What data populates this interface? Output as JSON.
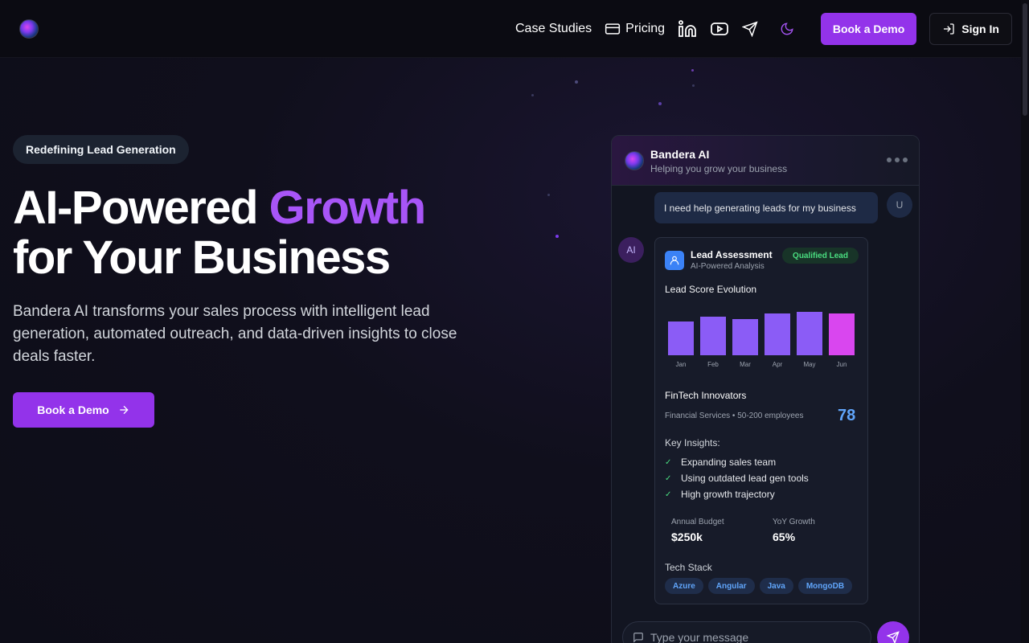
{
  "nav": {
    "case_studies": "Case Studies",
    "pricing": "Pricing",
    "book_demo": "Book a Demo",
    "sign_in": "Sign In",
    "icons": [
      "linkedin-icon",
      "youtube-icon",
      "send-icon",
      "moon-icon"
    ]
  },
  "hero": {
    "badge": "Redefining Lead Generation",
    "title_part1": "AI-Powered ",
    "title_accent": "Growth",
    "title_line2": "for Your Business",
    "subtitle": "Bandera AI transforms your sales process with intelligent lead generation, automated outreach, and data-driven insights to close deals faster.",
    "cta": "Book a Demo"
  },
  "chat": {
    "title": "Bandera AI",
    "subtitle": "Helping you grow your business",
    "user_message": "I need help generating leads for my business",
    "user_avatar": "U",
    "ai_avatar": "AI",
    "input_placeholder": "Type your message"
  },
  "card": {
    "title": "Lead Assessment",
    "subtitle": "AI-Powered Analysis",
    "badge": "Qualified Lead",
    "chart_label": "Lead Score Evolution",
    "company": "FinTech Innovators",
    "company_meta": "Financial Services • 50-200 employees",
    "score": "78",
    "insights_label": "Key Insights:",
    "insights": [
      "Expanding sales team",
      "Using outdated lead gen tools",
      "High growth trajectory"
    ],
    "budget_label": "Annual Budget",
    "budget_value": "$250k",
    "growth_label": "YoY Growth",
    "growth_value": "65%",
    "tech_label": "Tech Stack",
    "tech": [
      "Azure",
      "Angular",
      "Java",
      "MongoDB"
    ]
  },
  "chart_data": {
    "type": "bar",
    "categories": [
      "Jan",
      "Feb",
      "Mar",
      "Apr",
      "May",
      "Jun"
    ],
    "values": [
      42,
      48,
      45,
      52,
      54,
      52
    ],
    "highlight_last": true,
    "colors": {
      "bar": "#8b5cf6",
      "highlight": "#d946ef"
    }
  },
  "colors": {
    "accent": "#9333ea",
    "accent_text": "#a855f7",
    "score": "#60a5fa",
    "success": "#4ade80"
  }
}
